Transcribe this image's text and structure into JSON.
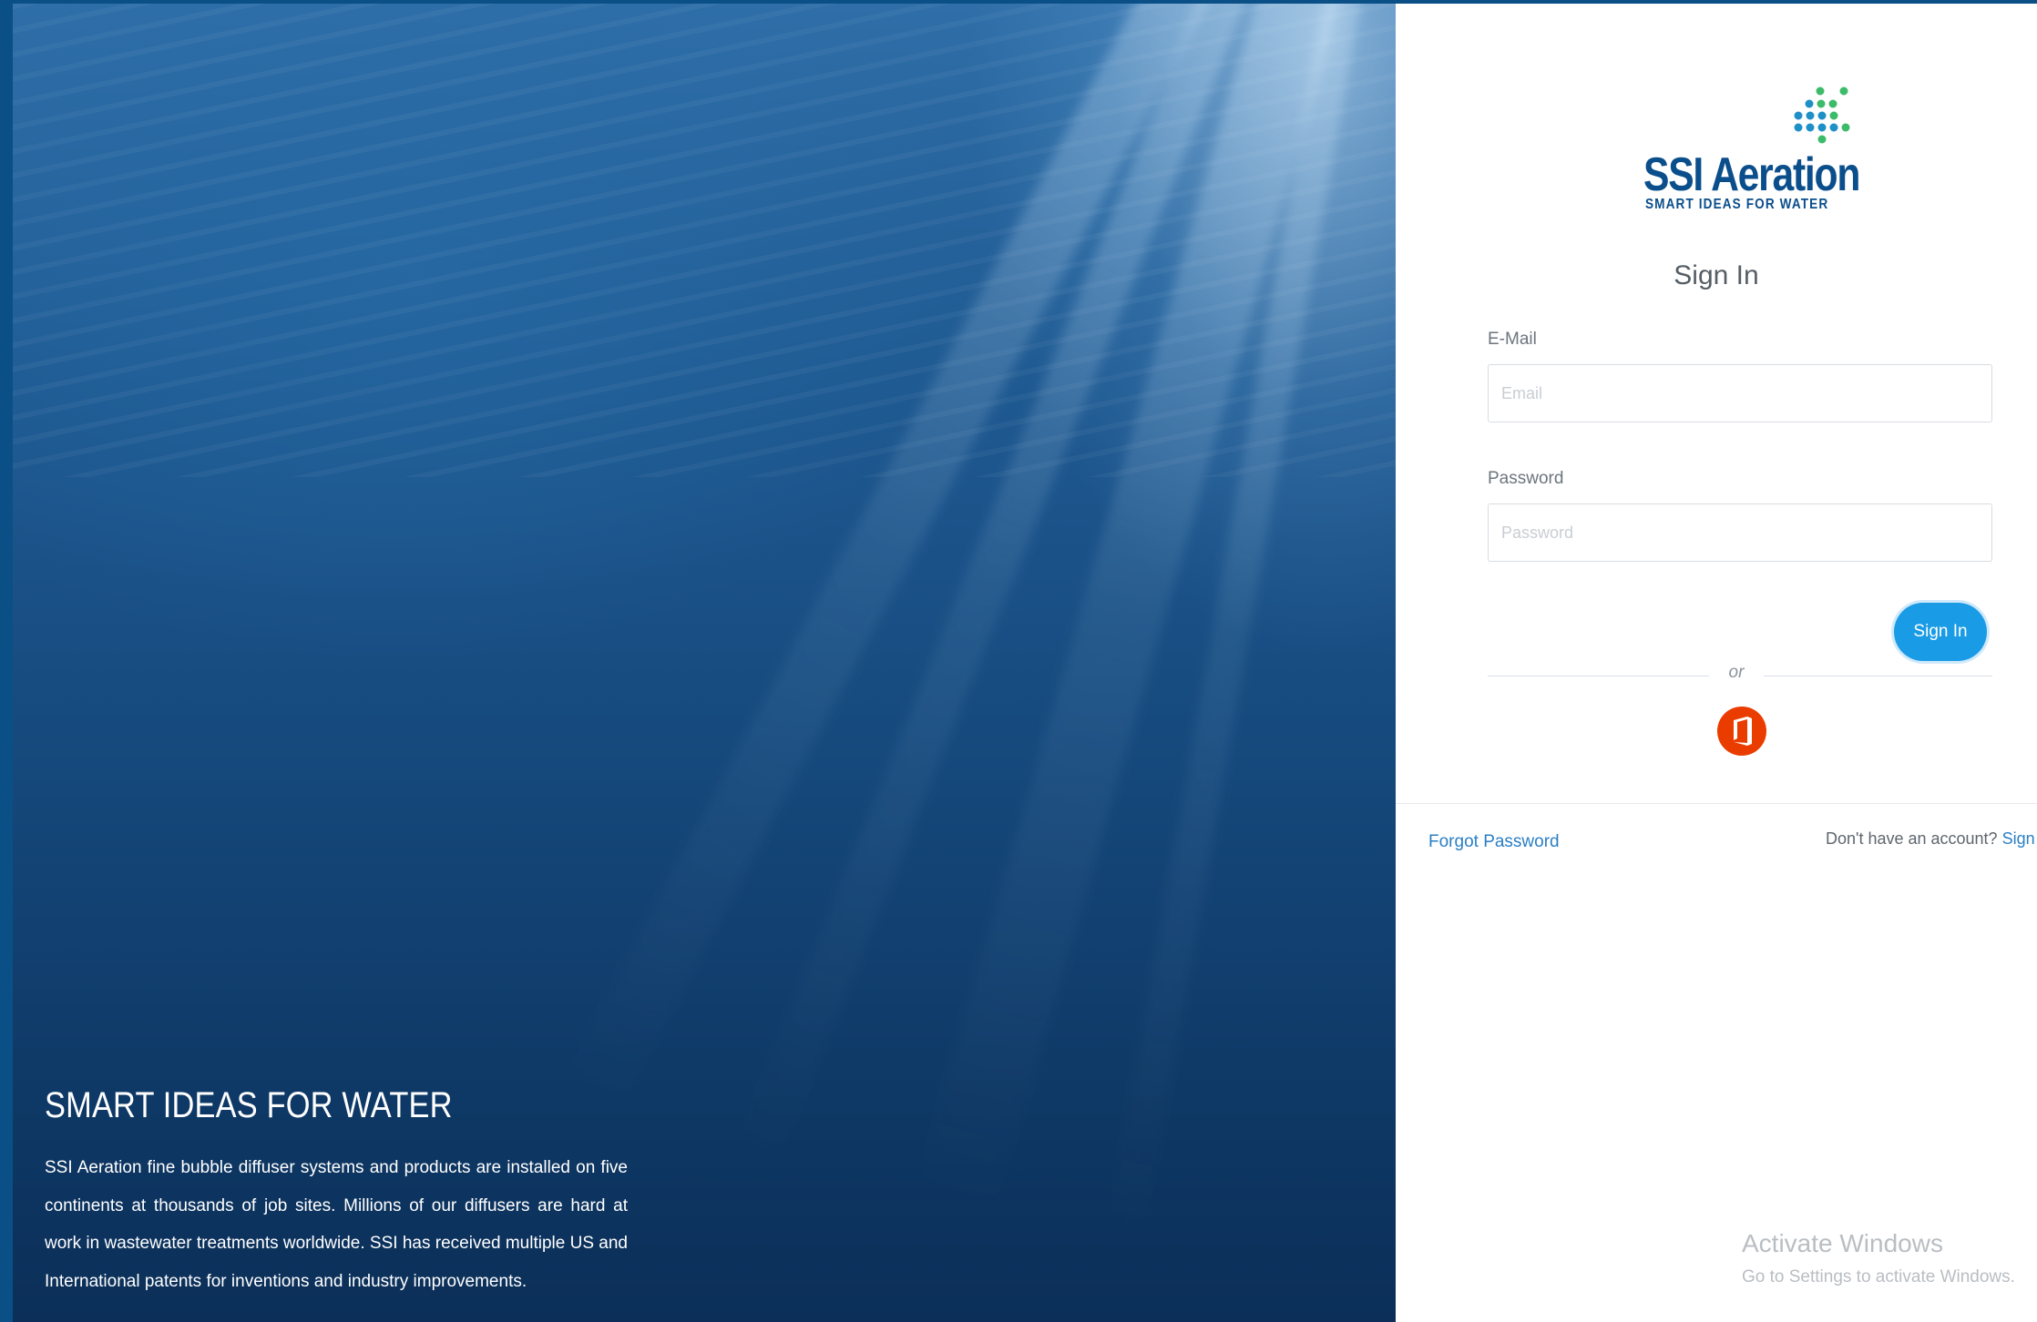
{
  "hero": {
    "title": "SMART IDEAS FOR WATER",
    "description": "SSI Aeration fine bubble diffuser systems and products are installed on five continents at thousands of job sites. Millions of our diffusers are hard at work in wastewater treatments worldwide. SSI has received multiple US and International patents for inventions and industry improvements."
  },
  "logo": {
    "brand": "SSI Aeration",
    "tagline": "SMART IDEAS FOR WATER",
    "colors": {
      "blue": "#0b4e8c",
      "green": "#3dbb6a",
      "teal": "#1f8fc7"
    }
  },
  "signin": {
    "heading": "Sign In",
    "email_label": "E-Mail",
    "email_placeholder": "Email",
    "password_label": "Password",
    "password_placeholder": "Password",
    "submit_label": "Sign In",
    "or_label": "or",
    "office_icon": "microsoft-office-icon"
  },
  "footer": {
    "forgot_password": "Forgot Password",
    "no_account": "Don't have an account?",
    "signup_link": "Sign Up N"
  },
  "watermark": {
    "title": "Activate Windows",
    "subtitle": "Go to Settings to activate Windows."
  },
  "colors": {
    "accent": "#1a9be6",
    "link": "#2a7fc4",
    "office": "#eb3c00"
  }
}
